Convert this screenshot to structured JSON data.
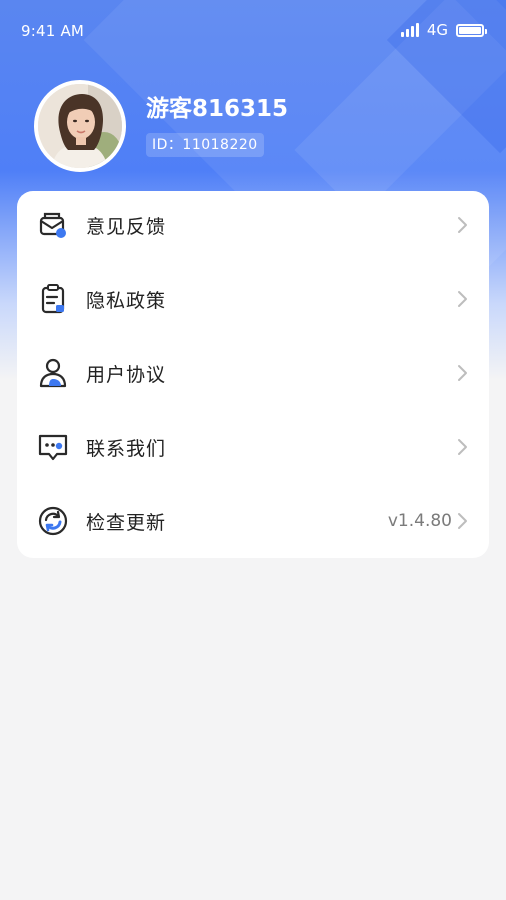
{
  "status_bar": {
    "time": "9:41 AM",
    "network": "4G"
  },
  "profile": {
    "name": "游客816315",
    "id_text": "ID：11018220"
  },
  "menu": {
    "items": [
      {
        "label": "意见反馈",
        "icon": "feedback-mail-icon"
      },
      {
        "label": "隐私政策",
        "icon": "privacy-clipboard-icon"
      },
      {
        "label": "用户协议",
        "icon": "user-agreement-icon"
      },
      {
        "label": "联系我们",
        "icon": "contact-chat-icon"
      },
      {
        "label": "检查更新",
        "icon": "update-refresh-icon",
        "value": "v1.4.80"
      }
    ]
  },
  "colors": {
    "accent": "#3d78f0",
    "header_blue": "#4f7ff7",
    "text": "#222222",
    "muted": "#7b7b7b"
  }
}
